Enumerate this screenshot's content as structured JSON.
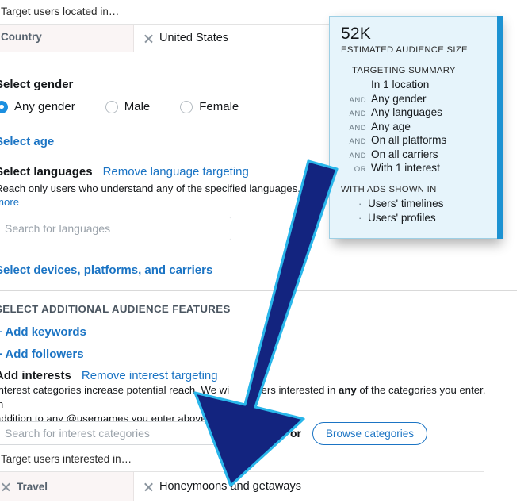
{
  "location": {
    "header": "Target users located in…",
    "rows": [
      {
        "key": "Country",
        "value": "United States"
      }
    ]
  },
  "gender": {
    "title": "Select gender",
    "options": [
      {
        "label": "Any gender",
        "selected": true
      },
      {
        "label": "Male",
        "selected": false
      },
      {
        "label": "Female",
        "selected": false
      }
    ]
  },
  "age": {
    "link": "Select age"
  },
  "languages": {
    "title": "Select languages",
    "remove_link": "Remove language targeting",
    "note": "Reach only users who understand any of the specified languages, or lea",
    "note_more": "more",
    "search_placeholder": "Search for languages"
  },
  "devices": {
    "link": "Select devices, platforms, and carriers"
  },
  "features": {
    "title": "SELECT ADDITIONAL AUDIENCE FEATURES",
    "add_keywords": "+ Add keywords",
    "add_followers": "+ Add followers",
    "interests_title": "Add interests",
    "interests_remove_link": "Remove interest targeting",
    "interests_note_line1_pre": "Interest categories increase potential reach. We wi",
    "interests_note_line1_mid": "ers interested in ",
    "interests_note_line1_bold": "any",
    "interests_note_line1_post": " of the categories you enter, in",
    "interests_note_line2": "addition to any @usernames you enter above.",
    "interest_search_placeholder": "Search for interest categories",
    "or_label": "or",
    "browse_button": "Browse categories"
  },
  "interests_table": {
    "header": "Target users interested in…",
    "rows": [
      {
        "category": "Travel",
        "value": "Honeymoons and getaways"
      }
    ]
  },
  "estimate": {
    "count": "52K",
    "count_caption": "ESTIMATED AUDIENCE SIZE",
    "summary_title": "TARGETING SUMMARY",
    "summary_lines": [
      {
        "conj": "",
        "value": "In 1 location"
      },
      {
        "conj": "AND",
        "value": "Any gender"
      },
      {
        "conj": "AND",
        "value": "Any languages"
      },
      {
        "conj": "AND",
        "value": "Any age"
      },
      {
        "conj": "AND",
        "value": "On all platforms"
      },
      {
        "conj": "AND",
        "value": "On all carriers"
      },
      {
        "conj": "OR",
        "value": "With 1 interest"
      }
    ],
    "ads_title": "WITH ADS SHOWN IN",
    "ads_lines": [
      "Users' timelines",
      "Users' profiles"
    ]
  },
  "colors": {
    "link": "#1b74c4",
    "panel_bg": "#e6f4fb",
    "panel_accent": "#1c92d2",
    "arrow_fill": "#13247f",
    "arrow_stroke": "#29b6ea",
    "radio_on": "#1b8fe0"
  }
}
